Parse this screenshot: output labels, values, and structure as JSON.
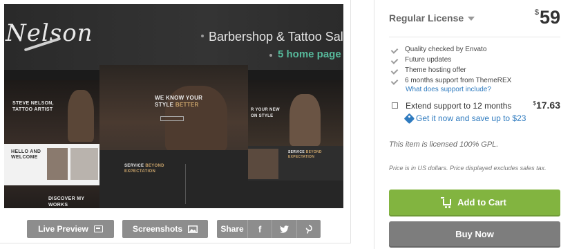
{
  "preview": {
    "logo_text": "Nelson",
    "banner_title": "Barbershop & Tattoo Salo",
    "banner_subtitle": "5 home page",
    "shot_a": {
      "heading_line1": "STEVE NELSON,",
      "heading_line2": "TATTOO ARTIST",
      "welcome_line1": "HELLO AND",
      "welcome_line2": "WELCOME",
      "discover_line1": "DISCOVER MY",
      "discover_line2": "WORKS"
    },
    "shot_b": {
      "heading_line1": "WE KNOW YOUR",
      "heading_line2_a": "STYLE ",
      "heading_line2_b": "BETTER",
      "service_a": "SERVICE ",
      "service_b": "BEYOND",
      "service_line2": "EXPECTATION"
    },
    "shot_c": {
      "heading_line1": "R YOUR NEW",
      "heading_line2": "ON STYLE",
      "service_a": "SERVICE ",
      "service_b": "BEYOND",
      "service_line2": "EXPECTATION"
    }
  },
  "buttons": {
    "live_preview": "Live Preview",
    "screenshots": "Screenshots",
    "share": "Share"
  },
  "license": {
    "label": "Regular License",
    "currency": "$",
    "price": "59"
  },
  "features": [
    "Quality checked by Envato",
    "Future updates",
    "Theme hosting offer",
    "6 months support from ThemeREX"
  ],
  "support_link": "What does support include?",
  "extend": {
    "label": "Extend support to 12 months",
    "currency": "$",
    "price": "17.63",
    "offer": "Get it now and save up to $23"
  },
  "gpl_text": "This item is licensed 100% GPL.",
  "price_note": "Price is in US dollars. Price displayed excludes sales tax.",
  "actions": {
    "add_to_cart": "Add to Cart",
    "buy_now": "Buy Now"
  },
  "colors": {
    "accent_green": "#82b440",
    "link_blue": "#2f7bbf",
    "teal": "#56b89a",
    "gold": "#c9a36a"
  }
}
